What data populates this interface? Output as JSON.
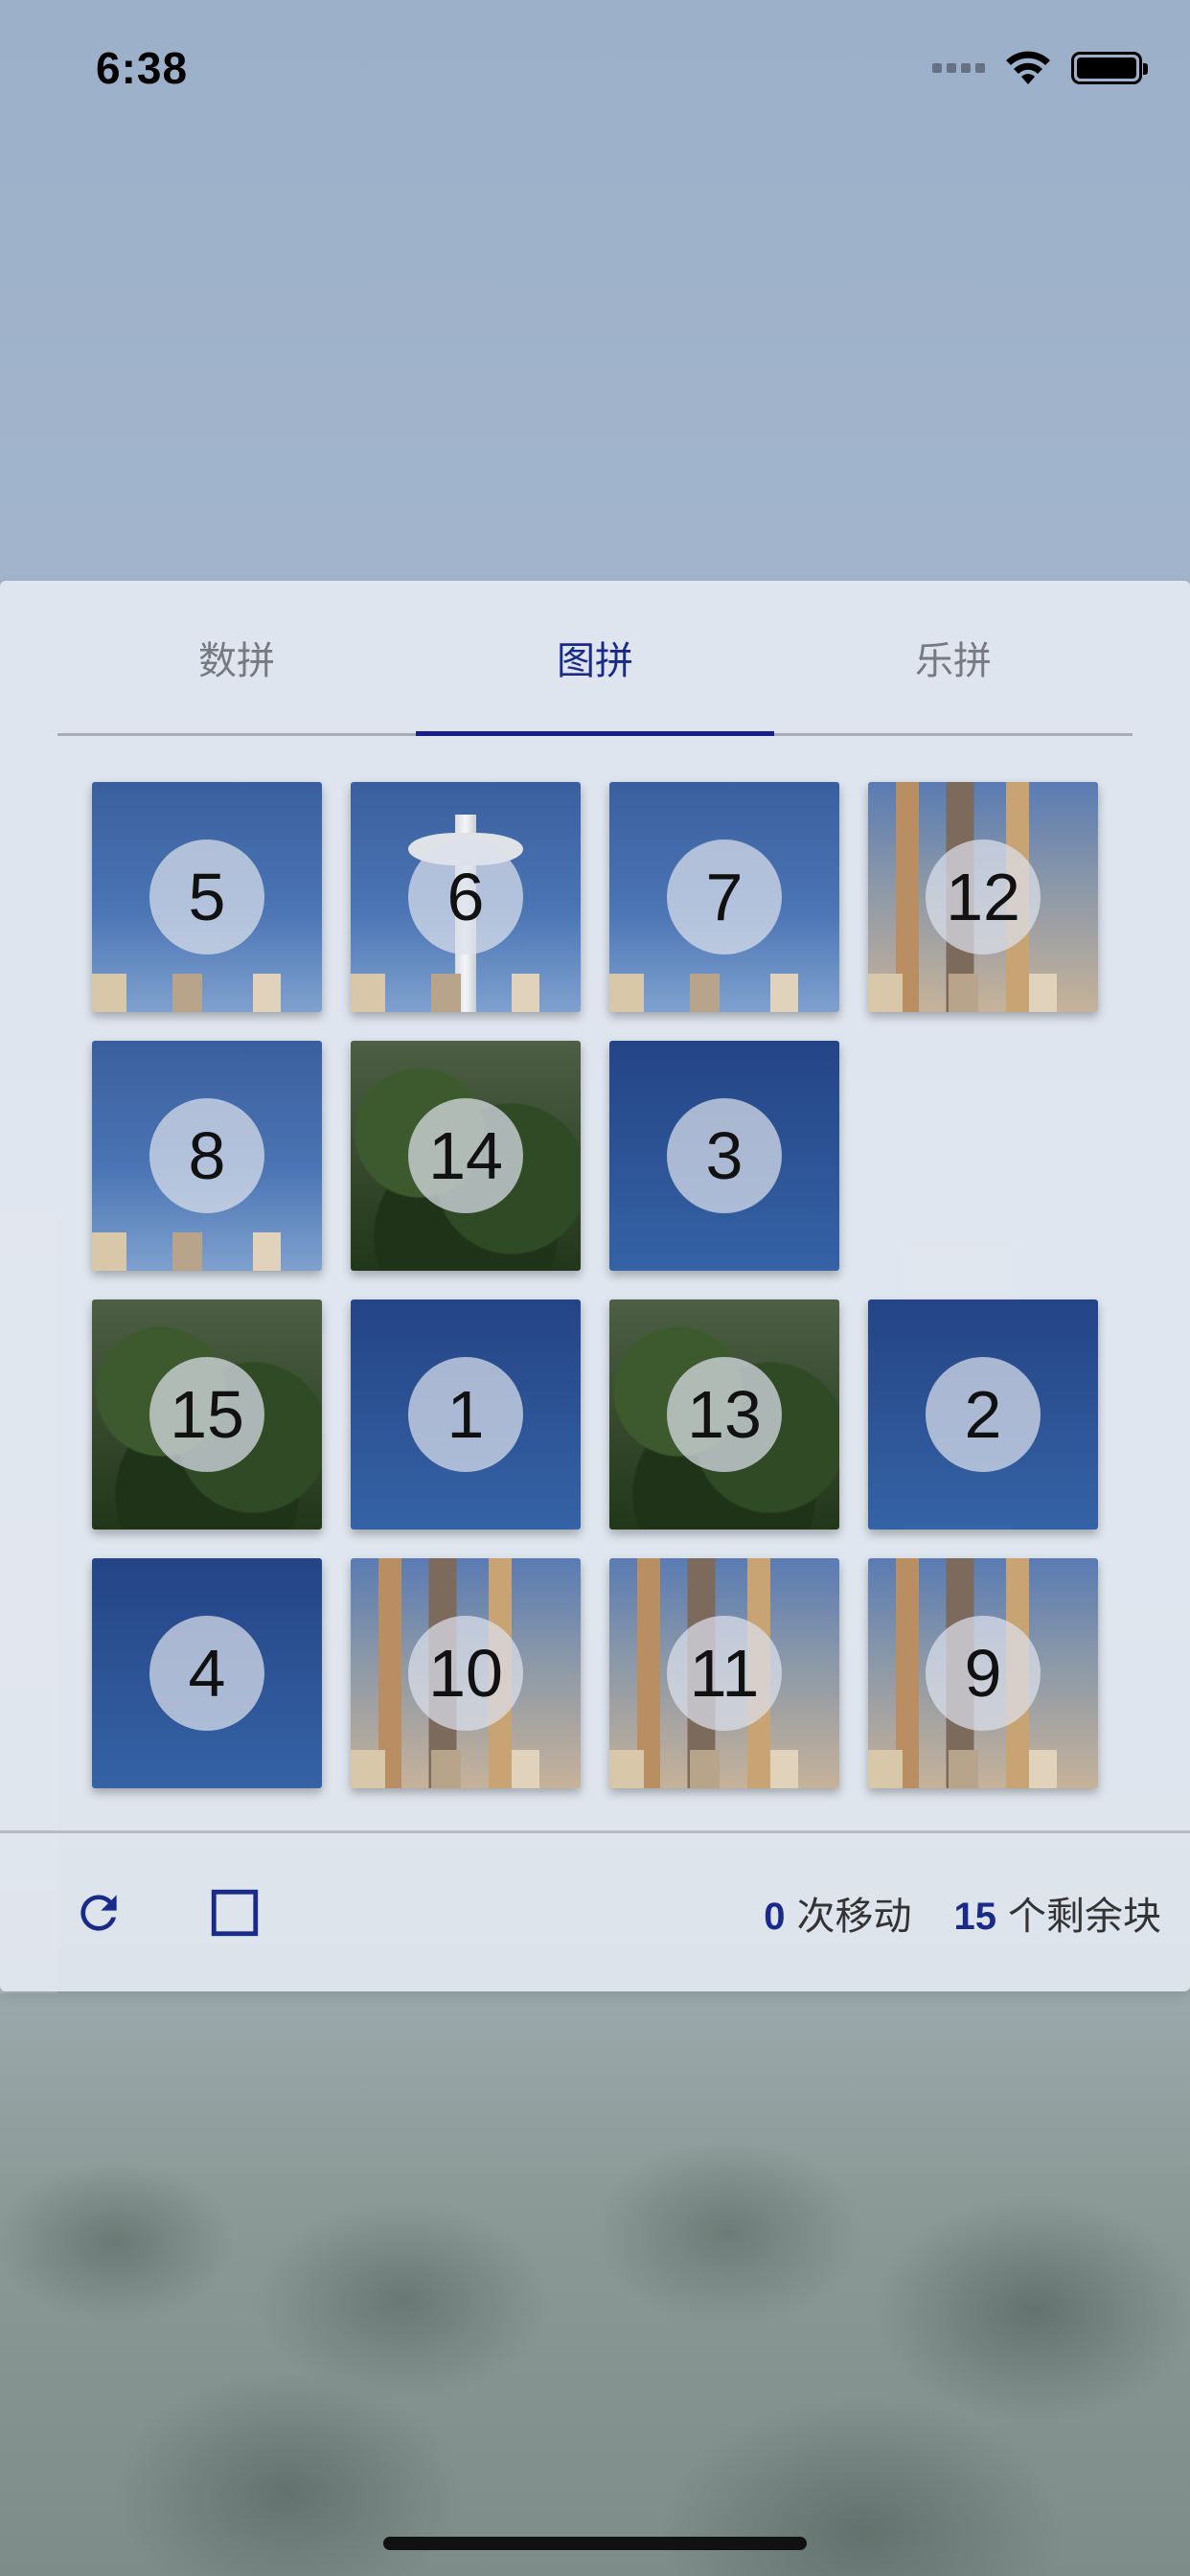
{
  "status_bar": {
    "time": "6:38"
  },
  "tabs": [
    {
      "label": "数拼",
      "active": false
    },
    {
      "label": "图拼",
      "active": true
    },
    {
      "label": "乐拼",
      "active": false
    }
  ],
  "board": {
    "size": 4,
    "tiles": [
      {
        "number": "5",
        "row": 0,
        "col": 0,
        "art": "sky"
      },
      {
        "number": "6",
        "row": 0,
        "col": 1,
        "art": "needle"
      },
      {
        "number": "7",
        "row": 0,
        "col": 2,
        "art": "sky"
      },
      {
        "number": "12",
        "row": 0,
        "col": 3,
        "art": "city"
      },
      {
        "number": "8",
        "row": 1,
        "col": 0,
        "art": "sky"
      },
      {
        "number": "14",
        "row": 1,
        "col": 1,
        "art": "tree"
      },
      {
        "number": "3",
        "row": 1,
        "col": 2,
        "art": "sky-deep"
      },
      {
        "number": "15",
        "row": 2,
        "col": 0,
        "art": "tree"
      },
      {
        "number": "1",
        "row": 2,
        "col": 1,
        "art": "sky-deep"
      },
      {
        "number": "13",
        "row": 2,
        "col": 2,
        "art": "tree"
      },
      {
        "number": "2",
        "row": 2,
        "col": 3,
        "art": "sky-deep"
      },
      {
        "number": "4",
        "row": 3,
        "col": 0,
        "art": "sky-deep"
      },
      {
        "number": "10",
        "row": 3,
        "col": 1,
        "art": "city"
      },
      {
        "number": "11",
        "row": 3,
        "col": 2,
        "art": "city"
      },
      {
        "number": "9",
        "row": 3,
        "col": 3,
        "art": "city"
      }
    ],
    "empty": {
      "row": 1,
      "col": 3
    }
  },
  "toolbar": {
    "refresh_icon": "refresh-icon",
    "stop_icon": "square-icon",
    "moves_count": "0",
    "moves_label": "次移动",
    "remaining_count": "15",
    "remaining_label": "个剩余块"
  },
  "colors": {
    "accent": "#1a2a8a",
    "tab_inactive": "#777a80"
  }
}
